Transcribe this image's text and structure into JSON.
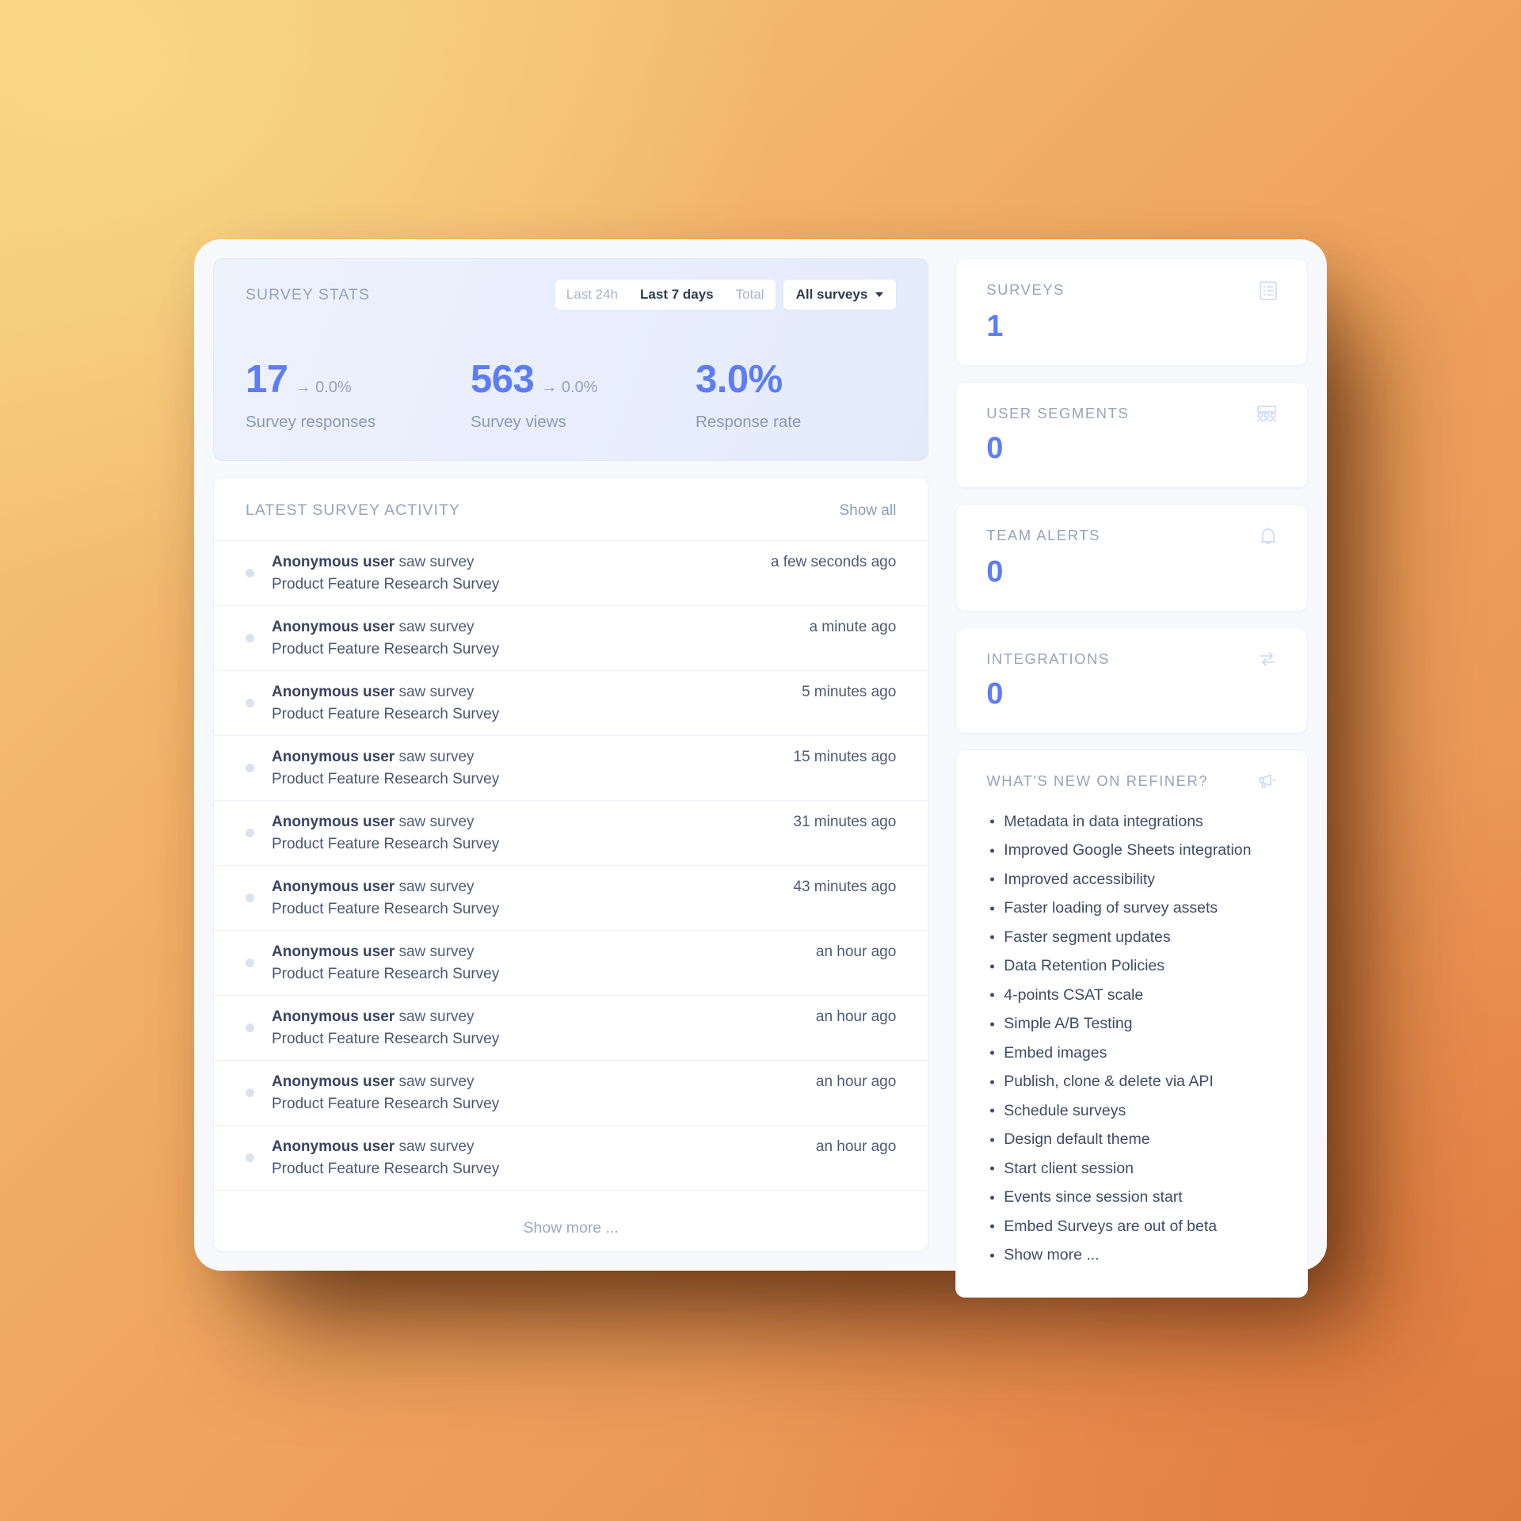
{
  "stats_panel": {
    "title": "SURVEY STATS",
    "filters": {
      "range_options": [
        "Last 24h",
        "Last 7 days",
        "Total"
      ],
      "selected_range": "Last 7 days",
      "survey_select": "All surveys"
    },
    "metrics": [
      {
        "value": "17",
        "delta": "→ 0.0%",
        "label": "Survey responses"
      },
      {
        "value": "563",
        "delta": "→ 0.0%",
        "label": "Survey views"
      },
      {
        "value": "3.0%",
        "delta": "",
        "label": "Response rate"
      }
    ]
  },
  "activity_panel": {
    "title": "LATEST SURVEY ACTIVITY",
    "show_all_label": "Show all",
    "show_more_label": "Show more ...",
    "rows": [
      {
        "actor": "Anonymous user",
        "action": "saw survey",
        "survey": "Product Feature Research Survey",
        "time": "a few seconds ago"
      },
      {
        "actor": "Anonymous user",
        "action": "saw survey",
        "survey": "Product Feature Research Survey",
        "time": "a minute ago"
      },
      {
        "actor": "Anonymous user",
        "action": "saw survey",
        "survey": "Product Feature Research Survey",
        "time": "5 minutes ago"
      },
      {
        "actor": "Anonymous user",
        "action": "saw survey",
        "survey": "Product Feature Research Survey",
        "time": "15 minutes ago"
      },
      {
        "actor": "Anonymous user",
        "action": "saw survey",
        "survey": "Product Feature Research Survey",
        "time": "31 minutes ago"
      },
      {
        "actor": "Anonymous user",
        "action": "saw survey",
        "survey": "Product Feature Research Survey",
        "time": "43 minutes ago"
      },
      {
        "actor": "Anonymous user",
        "action": "saw survey",
        "survey": "Product Feature Research Survey",
        "time": "an hour ago"
      },
      {
        "actor": "Anonymous user",
        "action": "saw survey",
        "survey": "Product Feature Research Survey",
        "time": "an hour ago"
      },
      {
        "actor": "Anonymous user",
        "action": "saw survey",
        "survey": "Product Feature Research Survey",
        "time": "an hour ago"
      },
      {
        "actor": "Anonymous user",
        "action": "saw survey",
        "survey": "Product Feature Research Survey",
        "time": "an hour ago"
      }
    ]
  },
  "side_cards": [
    {
      "title": "SURVEYS",
      "value": "1",
      "icon": "list-document-icon"
    },
    {
      "title": "USER SEGMENTS",
      "value": "0",
      "icon": "user-group-icon"
    },
    {
      "title": "TEAM ALERTS",
      "value": "0",
      "icon": "bell-icon"
    },
    {
      "title": "INTEGRATIONS",
      "value": "0",
      "icon": "sync-arrows-icon"
    }
  ],
  "news_panel": {
    "title": "WHAT'S NEW ON REFINER?",
    "icon": "megaphone-icon",
    "items": [
      "Metadata in data integrations",
      "Improved Google Sheets integration",
      "Improved accessibility",
      "Faster loading of survey assets",
      "Faster segment updates",
      "Data Retention Policies",
      "4-points CSAT scale",
      "Simple A/B Testing",
      "Embed images",
      "Publish, clone & delete via API",
      "Schedule surveys",
      "Design default theme",
      "Start client session",
      "Events since session start",
      "Embed Surveys are out of beta",
      "Show more ..."
    ]
  },
  "colors": {
    "accent_blue": "#5d7cf5",
    "text_dark": "#3f4c66",
    "muted": "#99a4ba",
    "card_bg": "#ffffff",
    "shell_bg": "#f7f9fc"
  }
}
